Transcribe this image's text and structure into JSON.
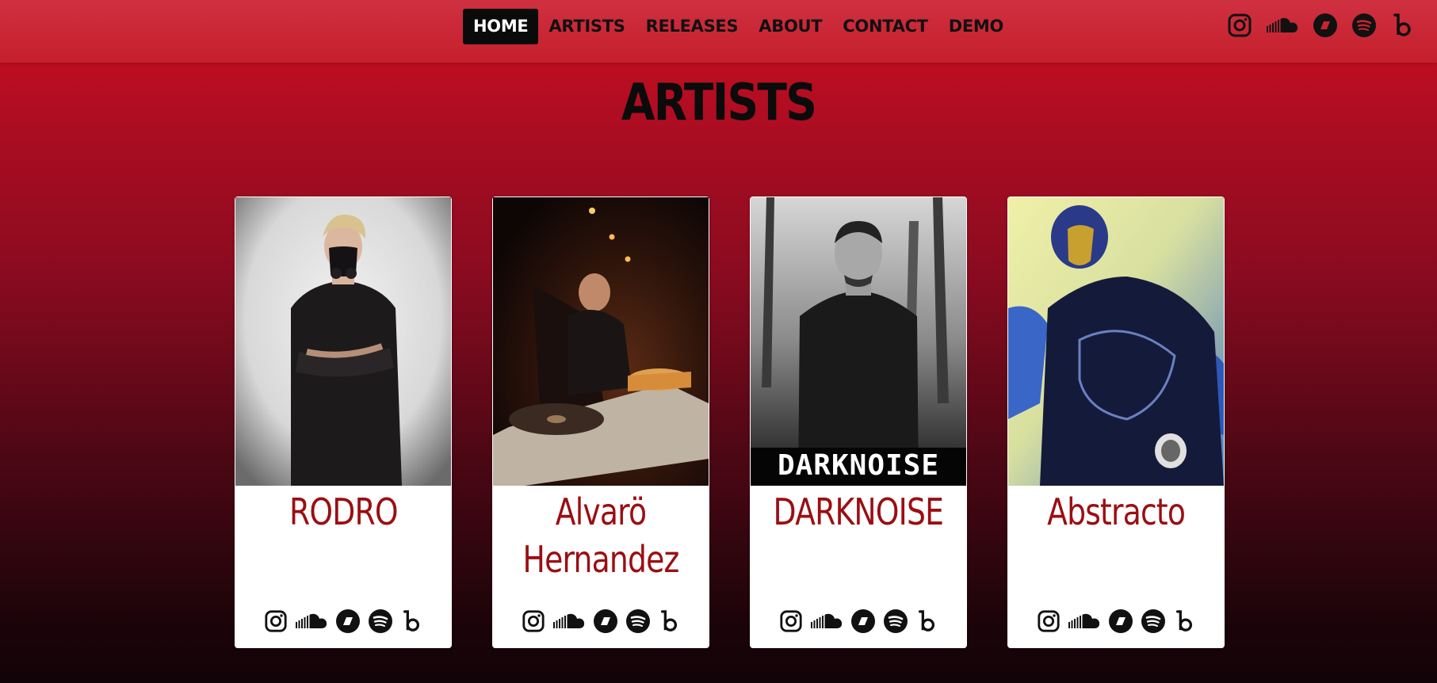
{
  "nav": {
    "items": [
      {
        "label": "HOME",
        "active": true
      },
      {
        "label": "ARTISTS",
        "active": false
      },
      {
        "label": "RELEASES",
        "active": false
      },
      {
        "label": "ABOUT",
        "active": false
      },
      {
        "label": "CONTACT",
        "active": false
      },
      {
        "label": "DEMO",
        "active": false
      }
    ],
    "social_icons": [
      "instagram-icon",
      "soundcloud-icon",
      "beatport-icon",
      "spotify-icon",
      "bandcamp-icon"
    ]
  },
  "page": {
    "title": "ARTISTS"
  },
  "artists": [
    {
      "name": "RODRO",
      "social_icons": [
        "instagram-icon",
        "soundcloud-icon",
        "beatport-icon",
        "spotify-icon",
        "bandcamp-icon"
      ]
    },
    {
      "name": "Alvarö Hernandez",
      "social_icons": [
        "instagram-icon",
        "soundcloud-icon",
        "beatport-icon",
        "spotify-icon",
        "bandcamp-icon"
      ]
    },
    {
      "name": "DARKNOISE",
      "photo_logo": "DARKNOISE",
      "social_icons": [
        "instagram-icon",
        "soundcloud-icon",
        "beatport-icon",
        "spotify-icon",
        "bandcamp-icon"
      ]
    },
    {
      "name": "Abstracto",
      "social_icons": [
        "instagram-icon",
        "soundcloud-icon",
        "beatport-icon",
        "spotify-icon",
        "bandcamp-icon"
      ]
    }
  ],
  "colors": {
    "header": "#c8232f",
    "nav_active_bg": "#0a0a0a",
    "artist_name": "#9b0e12",
    "card_bg": "#ffffff"
  }
}
